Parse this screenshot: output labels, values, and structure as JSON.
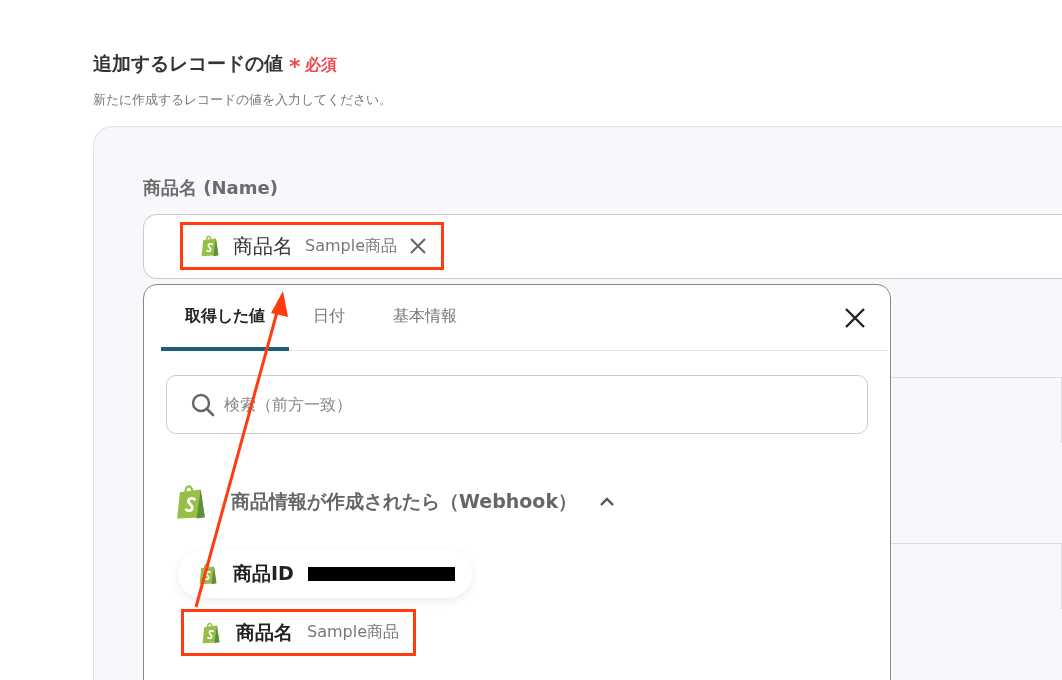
{
  "section": {
    "title": "追加するレコードの値",
    "required": {
      "mark": "*",
      "label": "必須"
    },
    "description": "新たに作成するレコードの値を入力してください。"
  },
  "field": {
    "label": "商品名 (Name)",
    "token": {
      "name": "商品名",
      "value": "Sample商品",
      "highlighted": true
    }
  },
  "picker": {
    "tabs": [
      {
        "label": "取得した値",
        "selected": true
      },
      {
        "label": "日付",
        "selected": false
      },
      {
        "label": "基本情報",
        "selected": false
      }
    ],
    "search": {
      "placeholder": "検索（前方一致）"
    },
    "group": {
      "title": "商品情報が作成されたら（Webhook）",
      "expanded": true,
      "items": [
        {
          "name": "商品ID",
          "redacted": true,
          "highlighted": false
        },
        {
          "name": "商品名",
          "value": "Sample商品",
          "redacted": false,
          "highlighted": true
        }
      ]
    }
  },
  "annotation": {
    "kind": "arrow"
  }
}
